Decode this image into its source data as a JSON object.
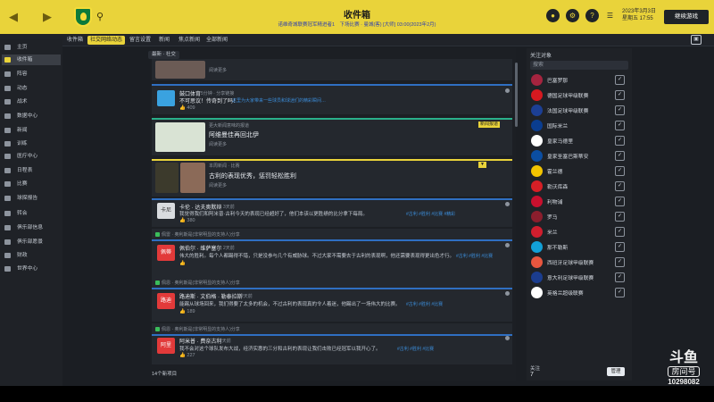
{
  "header": {
    "title": "收件箱",
    "subtitle": "诺维奇城联赛冠军精进者1　下场比赛 · 曼城(客) [大师] 03:00(2023年2月)",
    "date_line1": "2023年3月3日",
    "date_line2": "星期五 17:55",
    "continue_label": "继续游戏"
  },
  "tabs": [
    "收件箱",
    "社交网络动态",
    "留言设置",
    "新闻",
    "焦点新闻",
    "全部新闻"
  ],
  "sidebar": {
    "items": [
      "主页",
      "收件箱",
      "阵容",
      "动态",
      "战术",
      "数据中心",
      "新闻",
      "训练",
      "医疗中心",
      "日程表",
      "比赛",
      "球探报告",
      "转会",
      "俱乐部信息",
      "俱乐部愿景",
      "财政",
      "世界中心"
    ]
  },
  "feed": {
    "filter_label": "最新 · 社交",
    "footer": "14个新项目",
    "cards": [
      {
        "type": "cont",
        "meta": "阅读更多"
      },
      {
        "type": "post",
        "author": "鼓口体育",
        "time": "5分钟 · 分享链接",
        "title": "不可思议！传奇到了吗！",
        "link": "这里为大家带来一些球员和球迷们的精彩瞬间…",
        "likes": "409"
      },
      {
        "type": "news",
        "meta": "更大新闻意味的报道",
        "title": "阿维曼佳再回北伊",
        "more": "阅读更多",
        "badge": "新闻报道"
      },
      {
        "type": "news2",
        "meta": "本周新闻 · 比赛",
        "title": "古利的表现优秀，惩罚轻松胜利",
        "more": "阅读更多"
      },
      {
        "type": "comment",
        "avatar": "卡尼",
        "author": "卡伦 · 达夫奥默辩",
        "time": "3天前",
        "text": "我觉得我们和阿米普·古利今天的表现已经超好了，他们本该以更胜绩的比分拿下每局。",
        "links": "#古利 #胜利 #比赛 #精彩",
        "likes": "380"
      },
      {
        "type": "reply",
        "share": "佩雷 · 奥利斯是(非常明显的支持人)分享",
        "avatar": "佩蒂",
        "author": "佩伯尔 · 维萨塞尔",
        "time": "2天前",
        "text": "伟大的胜利。每个人都踢得不错，只是没参与几个有威胁球。不过大家不需要去于古利的表现啊，他还需要表现得更出色才行。",
        "links": "#古利 #胜利 #比赛",
        "likes": ""
      },
      {
        "type": "reply",
        "share": "佩恩 · 奥利斯是(非常明显的支持人)分享",
        "avatar": "路迪",
        "author": "路迪斯 · 文伯格 · 勒泰拉斯",
        "time": "2天前",
        "text": "能踢从球场回来，我们得要了太多的机会，不过古利的表现真的令人着迷，他踢出了一场伟大的比赛。",
        "links": "#古利 #胜利 #比赛",
        "likes": "189"
      },
      {
        "type": "reply",
        "share": "佩恩 · 奥利斯是(非常明显的支持人)分享",
        "avatar": "阿里",
        "author": "阿米普 · 费奈古利",
        "time": "2天前",
        "text": "我不会对这个球队发布大战，经济实惠的三分和古利的表现让我们击败已经冠军以我开心了。",
        "links": "#古利 #胜利 #比赛",
        "likes": "227"
      }
    ]
  },
  "right_panel": {
    "heading": "关注对象",
    "search_placeholder": "搜索",
    "items": [
      {
        "name": "巴塞罗那",
        "color": "#a5243f"
      },
      {
        "name": "德国足球甲级联赛",
        "color": "#d71920"
      },
      {
        "name": "法国足球甲级联赛",
        "color": "#1c3f94"
      },
      {
        "name": "国际米兰",
        "color": "#0a3d8f"
      },
      {
        "name": "皇家马德里",
        "color": "#ffffff"
      },
      {
        "name": "皇家圣塞巴斯蒂安",
        "color": "#0b4ea2"
      },
      {
        "name": "霍兰德",
        "color": "#f2c400"
      },
      {
        "name": "勒沃库森",
        "color": "#d61f26"
      },
      {
        "name": "利物浦",
        "color": "#c8102e"
      },
      {
        "name": "罗马",
        "color": "#8b1e2d"
      },
      {
        "name": "米兰",
        "color": "#d01e2e"
      },
      {
        "name": "那不勒斯",
        "color": "#12a0d7"
      },
      {
        "name": "西班牙足球甲级联赛",
        "color": "#e8563f"
      },
      {
        "name": "意大利足球甲级联赛",
        "color": "#1b3d8f"
      },
      {
        "name": "英格兰超级联赛",
        "color": "#ffffff"
      }
    ],
    "follow_label": "关注",
    "follow_count": "7",
    "manage_label": "管理"
  },
  "watermark": {
    "line1": "斗鱼",
    "line2": "房间号",
    "line3": "10298082"
  }
}
